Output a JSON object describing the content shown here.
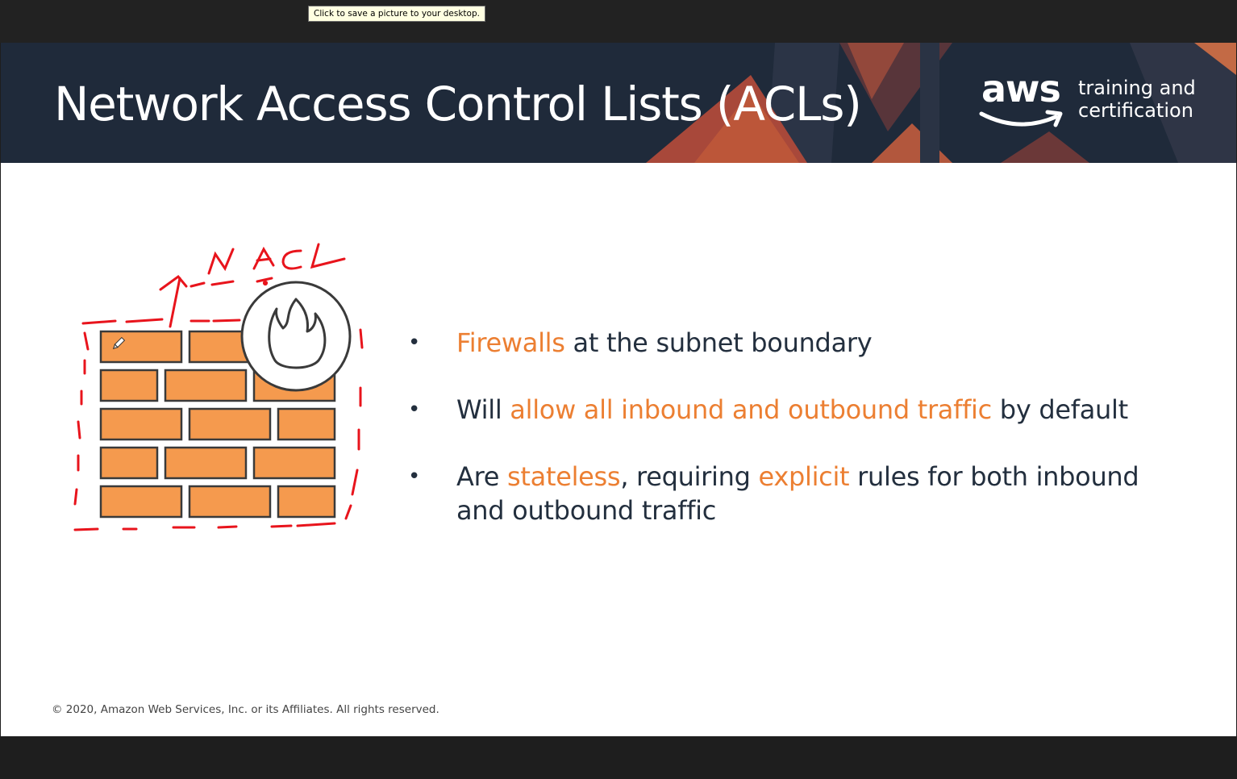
{
  "window": {
    "tooltip": "Click to save a picture to your desktop."
  },
  "slide": {
    "title": "Network Access Control Lists (ACLs)",
    "logo": {
      "wordmark": "aws",
      "tagline_line1": "training and",
      "tagline_line2": "certification"
    },
    "annotation": "NACL",
    "bullets": [
      {
        "parts": [
          {
            "text": "Firewalls",
            "highlight": true
          },
          {
            "text": " at the subnet boundary",
            "highlight": false
          }
        ]
      },
      {
        "parts": [
          {
            "text": "Will ",
            "highlight": false
          },
          {
            "text": "allow all inbound and outbound traffic",
            "highlight": true
          },
          {
            "text": " by default",
            "highlight": false
          }
        ]
      },
      {
        "parts": [
          {
            "text": "Are ",
            "highlight": false
          },
          {
            "text": "stateless",
            "highlight": true
          },
          {
            "text": ", requiring ",
            "highlight": false
          },
          {
            "text": "explicit",
            "highlight": true
          },
          {
            "text": " rules for both inbound and outbound traffic",
            "highlight": false
          }
        ]
      }
    ],
    "footer": "© 2020, Amazon Web Services, Inc. or its Affiliates. All rights reserved."
  },
  "colors": {
    "header_bg": "#1f2a3a",
    "highlight": "#ec7f32",
    "brick": "#f59a4e",
    "annotation": "#e8141c"
  },
  "icons": {
    "firewall": "firewall-icon",
    "flame": "flame-icon",
    "pencil_cursor": "pencil-cursor-icon"
  }
}
